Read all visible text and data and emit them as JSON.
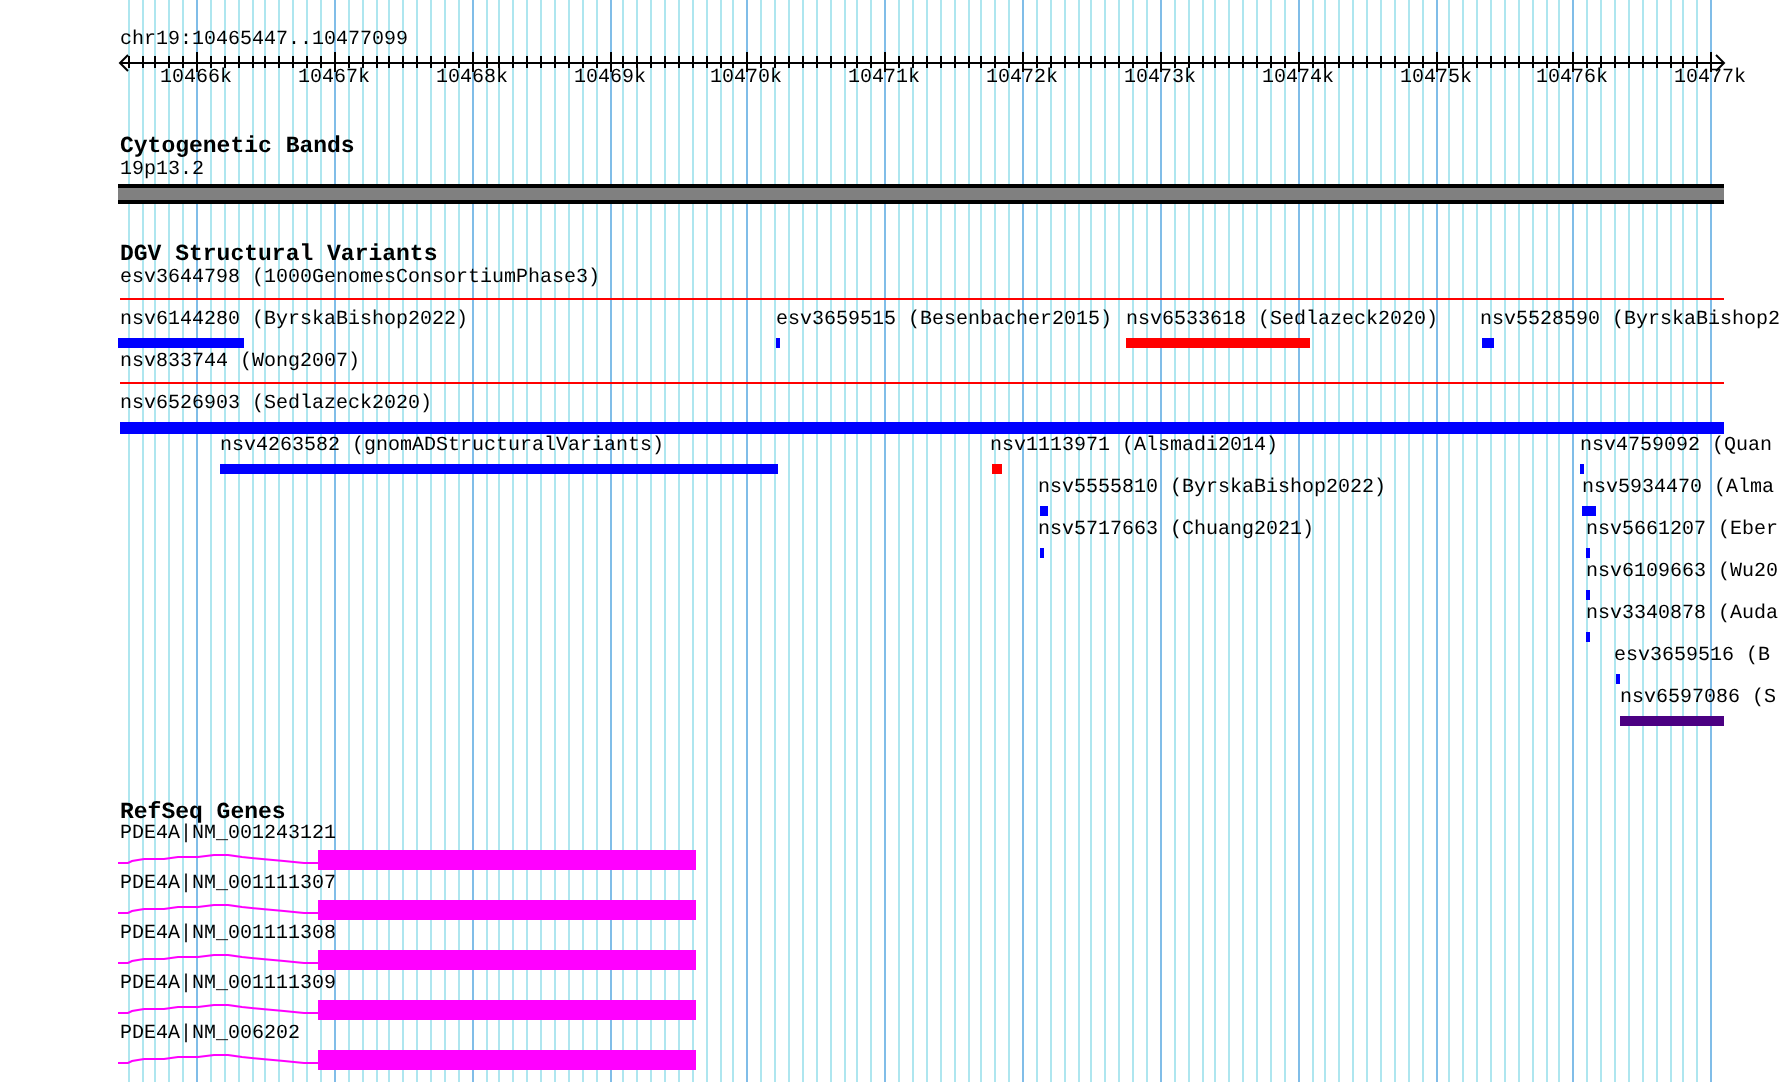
{
  "ruler": {
    "location": "chr19:10465447..10477099",
    "tick_labels": [
      "10466k",
      "10467k",
      "10468k",
      "10469k",
      "10470k",
      "10471k",
      "10472k",
      "10473k",
      "10474k",
      "10475k",
      "10476k",
      "10477k"
    ]
  },
  "tracks": [
    {
      "kind": "bands",
      "title": "Cytogenetic Bands",
      "features": [
        {
          "label": "19p13.2"
        }
      ]
    },
    {
      "kind": "variants",
      "title": "DGV Structural Variants",
      "features": [
        {
          "label": "esv3644798 (1000GenomesConsortiumPhase3)",
          "kind": "line",
          "color": "#ff0000"
        },
        {
          "label": "nsv6144280 (ByrskaBishop2022)",
          "kind": "bar",
          "color": "#0000ff"
        },
        {
          "label": "esv3659515 (Besenbacher2015)",
          "kind": "bar",
          "color": "#0000ff"
        },
        {
          "label": "nsv6533618 (Sedlazeck2020)",
          "kind": "bar",
          "color": "#ff0000"
        },
        {
          "label": "nsv5528590 (ByrskaBishop2",
          "kind": "bar",
          "color": "#0000ff"
        },
        {
          "label": "nsv833744 (Wong2007)",
          "kind": "line",
          "color": "#ff0000"
        },
        {
          "label": "nsv6526903 (Sedlazeck2020)",
          "kind": "bar",
          "color": "#0000ff"
        },
        {
          "label": "nsv4263582 (gnomADStructuralVariants)",
          "kind": "bar",
          "color": "#0000ff"
        },
        {
          "label": "nsv1113971 (Alsmadi2014)",
          "kind": "bar",
          "color": "#ff0000"
        },
        {
          "label": "nsv4759092 (Quan",
          "kind": "bar",
          "color": "#0000ff"
        },
        {
          "label": "nsv5555810 (ByrskaBishop2022)",
          "kind": "bar",
          "color": "#0000ff"
        },
        {
          "label": "nsv5934470 (Alma",
          "kind": "bar",
          "color": "#0000ff"
        },
        {
          "label": "nsv5717663 (Chuang2021)",
          "kind": "bar",
          "color": "#0000ff"
        },
        {
          "label": "nsv5661207 (Eber",
          "kind": "bar",
          "color": "#0000ff"
        },
        {
          "label": "nsv6109663 (Wu20",
          "kind": "bar",
          "color": "#0000ff"
        },
        {
          "label": "nsv3340878 (Auda",
          "kind": "bar",
          "color": "#0000ff"
        },
        {
          "label": "esv3659516 (B",
          "kind": "bar",
          "color": "#0000ff"
        },
        {
          "label": "nsv6597086 (S",
          "kind": "bar",
          "color": "#4b0082"
        }
      ]
    },
    {
      "kind": "genes",
      "title": "RefSeq Genes",
      "features": [
        {
          "label": "PDE4A|NM_001243121"
        },
        {
          "label": "PDE4A|NM_001111307"
        },
        {
          "label": "PDE4A|NM_001111308"
        },
        {
          "label": "PDE4A|NM_001111309"
        },
        {
          "label": "PDE4A|NM_006202"
        }
      ]
    }
  ]
}
